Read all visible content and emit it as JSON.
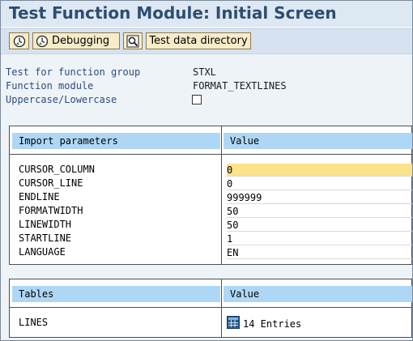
{
  "window": {
    "title": "Test Function Module: Initial Screen"
  },
  "toolbar": {
    "execute_icon": "execute-clock-icon",
    "debugging_label": "Debugging",
    "debug_icon": "execute-clock-icon",
    "find_icon": "find-icon",
    "test_data_label": "Test data directory"
  },
  "header_fields": {
    "function_group_label": "Test for function group",
    "function_group_value": "STXL",
    "function_module_label": "Function module",
    "function_module_value": "FORMAT_TEXTLINES",
    "case_label": "Uppercase/Lowercase",
    "case_checked": false
  },
  "import_table": {
    "col_name": "Import parameters",
    "col_value": "Value",
    "rows": [
      {
        "name": "CURSOR_COLUMN",
        "value": "0"
      },
      {
        "name": "CURSOR_LINE",
        "value": "0"
      },
      {
        "name": "ENDLINE",
        "value": "999999"
      },
      {
        "name": "FORMATWIDTH",
        "value": "50"
      },
      {
        "name": "LINEWIDTH",
        "value": "50"
      },
      {
        "name": "STARTLINE",
        "value": "1"
      },
      {
        "name": "LANGUAGE",
        "value": "EN"
      }
    ]
  },
  "tables_table": {
    "col_name": "Tables",
    "col_value": "Value",
    "rows": [
      {
        "name": "LINES",
        "icon": "table-grid-icon",
        "value": "14 Entries"
      }
    ]
  },
  "colors": {
    "title": "#2e4d71",
    "header_bg": "#aed7f5",
    "active_field": "#fce28a",
    "button_bg": "#f6ecc8"
  }
}
